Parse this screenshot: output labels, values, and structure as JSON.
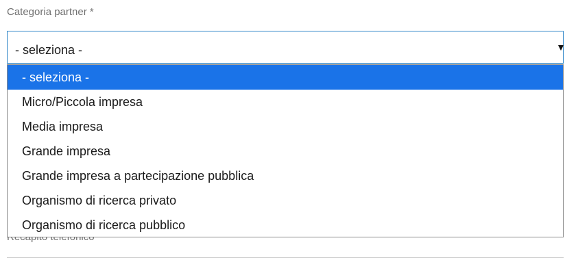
{
  "form": {
    "category_label": "Categoria partner *",
    "category_select": {
      "selected_value": "- seleziona -",
      "options": [
        "- seleziona -",
        "Micro/Piccola impresa",
        "Media impresa",
        "Grande impresa",
        "Grande impresa a partecipazione pubblica",
        "Organismo di ricerca privato",
        "Organismo di ricerca pubblico"
      ],
      "highlighted_index": 0
    },
    "phone_label": "Recapito telefonico"
  },
  "colors": {
    "highlight": "#1a73e8",
    "select_border": "#2f86c8",
    "label": "#707070"
  }
}
